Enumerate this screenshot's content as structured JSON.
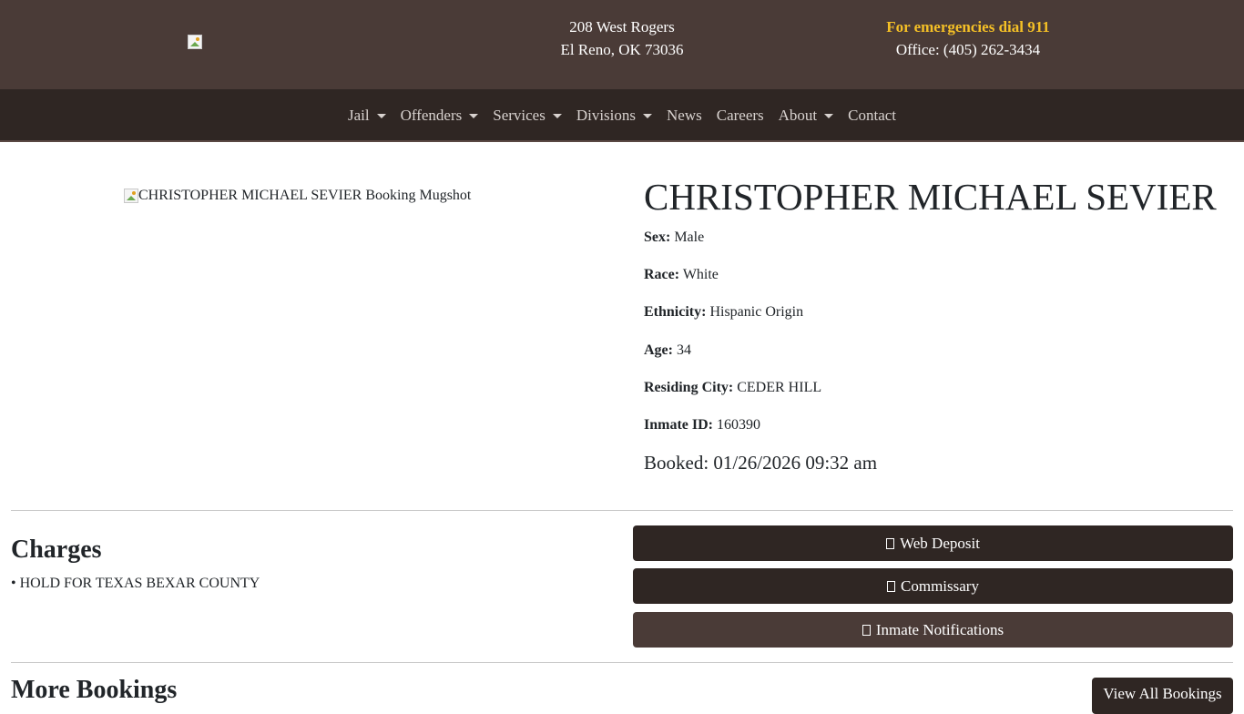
{
  "header": {
    "address_line1": "208 West Rogers",
    "address_line2": "El Reno, OK 73036",
    "emergency": "For emergencies dial 911",
    "office": "Office: (405) 262-3434",
    "logo_icon": "broken-image-icon"
  },
  "nav": {
    "items": [
      {
        "label": "Jail",
        "dropdown": true
      },
      {
        "label": "Offenders",
        "dropdown": true
      },
      {
        "label": "Services",
        "dropdown": true
      },
      {
        "label": "Divisions",
        "dropdown": true
      },
      {
        "label": "News",
        "dropdown": false
      },
      {
        "label": "Careers",
        "dropdown": false
      },
      {
        "label": "About",
        "dropdown": true
      },
      {
        "label": "Contact",
        "dropdown": false
      }
    ]
  },
  "inmate": {
    "mugshot_alt": "CHRISTOPHER MICHAEL SEVIER Booking Mugshot",
    "name": "CHRISTOPHER MICHAEL SEVIER",
    "fields": [
      {
        "label": "Sex:",
        "value": "Male"
      },
      {
        "label": "Race:",
        "value": "White"
      },
      {
        "label": "Ethnicity:",
        "value": "Hispanic Origin"
      },
      {
        "label": "Age:",
        "value": "34"
      },
      {
        "label": "Residing City:",
        "value": "CEDER HILL"
      },
      {
        "label": "Inmate ID:",
        "value": "160390"
      }
    ],
    "booked": "Booked: 01/26/2026 09:32 am"
  },
  "charges": {
    "title": "Charges",
    "items": [
      "• HOLD FOR TEXAS BEXAR COUNTY"
    ]
  },
  "actions": {
    "web_deposit": "Web Deposit",
    "commissary": "Commissary",
    "notifications": "Inmate Notifications"
  },
  "more": {
    "title": "More Bookings",
    "view_all": "View All Bookings"
  },
  "colors": {
    "header_bg": "#4a3b37",
    "nav_bg": "#2f2623",
    "accent": "#f5c026"
  }
}
